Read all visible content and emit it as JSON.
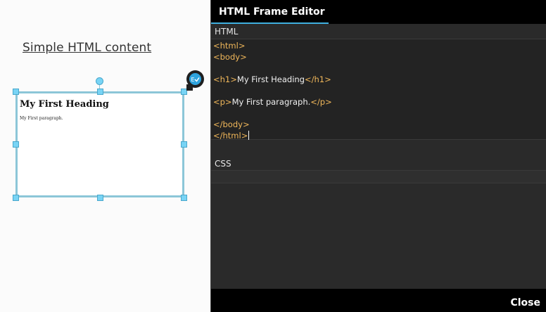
{
  "canvas": {
    "title": "Simple HTML content",
    "frame_preview": {
      "heading": "My First Heading",
      "paragraph": "My First paragraph."
    },
    "edit_badge_icon": "edit-check-icon"
  },
  "editor": {
    "title": "HTML Frame Editor",
    "html_label": "HTML",
    "css_label": "CSS",
    "html_code": [
      {
        "tag_open": "<html>",
        "text": "",
        "tag_close": ""
      },
      {
        "tag_open": "<body>",
        "text": "",
        "tag_close": ""
      },
      {
        "tag_open": "",
        "text": "",
        "tag_close": ""
      },
      {
        "tag_open": "<h1>",
        "text": "My First Heading",
        "tag_close": "</h1>"
      },
      {
        "tag_open": "",
        "text": "",
        "tag_close": ""
      },
      {
        "tag_open": "<p>",
        "text": "My First paragraph.",
        "tag_close": "</p>"
      },
      {
        "tag_open": "",
        "text": "",
        "tag_close": ""
      },
      {
        "tag_open": "</body>",
        "text": "",
        "tag_close": ""
      },
      {
        "tag_open": "</html>",
        "text": "",
        "tag_close": ""
      }
    ],
    "css_code": "",
    "close_label": "Close"
  },
  "colors": {
    "accent": "#3fb0e0",
    "tag_color": "#f0b75a",
    "handle_color": "#78d4f5"
  }
}
